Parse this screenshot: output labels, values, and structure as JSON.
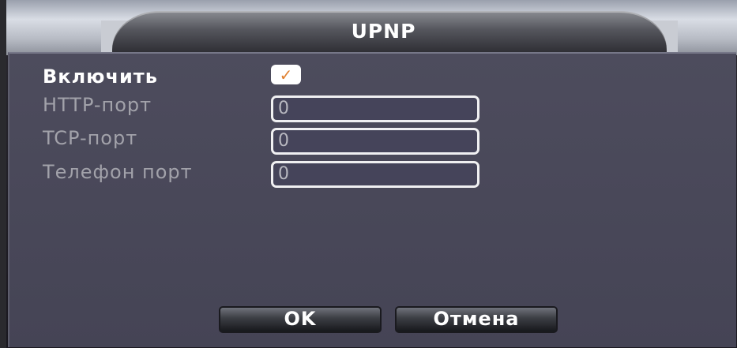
{
  "window": {
    "title": "UPNP"
  },
  "form": {
    "enable_label": "Включить",
    "enable_checked": true,
    "http_port_label": "HTTP-порт",
    "http_port_value": "0",
    "tcp_port_label": "TCP-порт",
    "tcp_port_value": "0",
    "phone_port_label": "Телефон порт",
    "phone_port_value": "0"
  },
  "buttons": {
    "ok_label": "OK",
    "cancel_label": "Отмена"
  },
  "colors": {
    "panel": "#4d4c5d",
    "checkmark": "#e08030",
    "field_border": "#f0f0f2"
  }
}
